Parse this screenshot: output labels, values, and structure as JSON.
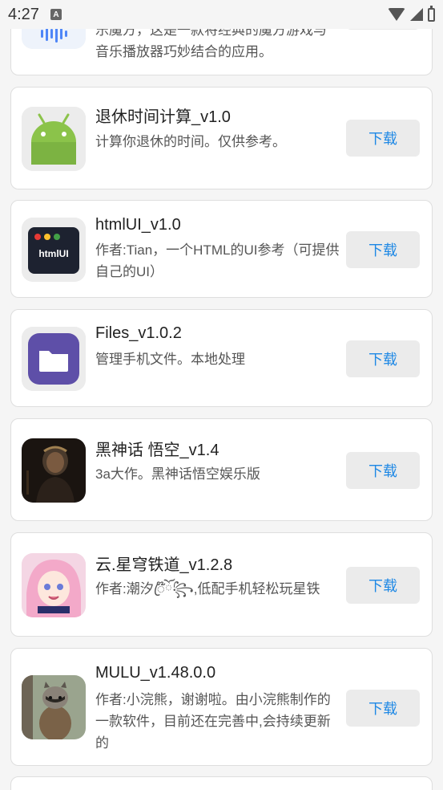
{
  "status_bar": {
    "time": "4:27",
    "notification_glyph": "A"
  },
  "apps": [
    {
      "icon": "music-wave-icon",
      "title": "",
      "desc": "乐魔方，这是一款将经典的魔方游戏与音乐播放器巧妙结合的应用。",
      "button": "下载"
    },
    {
      "icon": "android-robot-icon",
      "title": "退休时间计算_v1.0",
      "desc": "计算你退休的时间。仅供参考。",
      "button": "下载"
    },
    {
      "icon": "html-ui-icon",
      "icon_text": "htmlUI",
      "title": "htmlUI_v1.0",
      "desc": "作者:Tian，一个HTML的UI参考（可提供自己的UI）",
      "button": "下载"
    },
    {
      "icon": "folder-icon",
      "title": "Files_v1.0.2",
      "desc": "管理手机文件。本地处理",
      "button": "下载"
    },
    {
      "icon": "wukong-portrait-icon",
      "title": "黑神话 悟空_v1.4",
      "desc": "3a大作。黑神话悟空娱乐版",
      "button": "下载"
    },
    {
      "icon": "anime-girl-icon",
      "title": "云.星穹铁道_v1.2.8",
      "desc": "作者:潮汐ꦿ໊ོ꧂,低配手机轻松玩星铁",
      "button": "下载"
    },
    {
      "icon": "raccoon-photo-icon",
      "title": "MULU_v1.48.0.0",
      "desc": "作者:小浣熊，谢谢啦。由小浣熊制作的一款软件，目前还在完善中,会持续更新的",
      "button": "下载"
    }
  ]
}
